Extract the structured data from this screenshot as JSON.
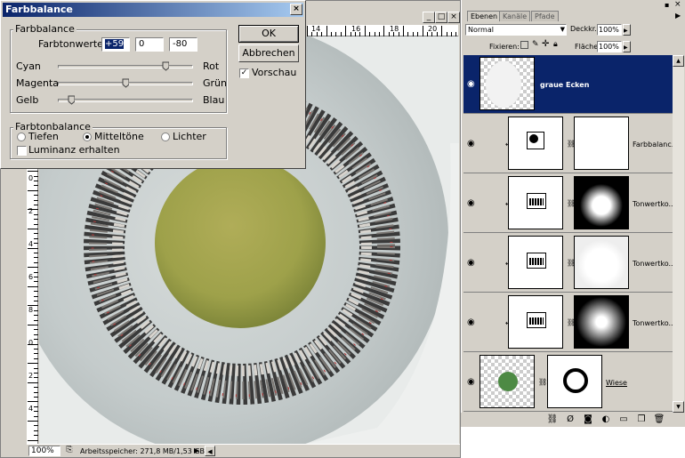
{
  "dialog": {
    "title": "Farbbalance",
    "close": "×",
    "group1_label": "Farbbalance",
    "values_label": "Farbtonwerte:",
    "values": [
      "+59",
      "0",
      "-80"
    ],
    "sliders": [
      {
        "left": "Cyan",
        "right": "Rot",
        "value": 59
      },
      {
        "left": "Magenta",
        "right": "Grün",
        "value": 0
      },
      {
        "left": "Gelb",
        "right": "Blau",
        "value": -80
      }
    ],
    "group2_label": "Farbtonbalance",
    "tones": [
      "Tiefen",
      "Mitteltöne",
      "Lichter"
    ],
    "tone_selected": "Mitteltöne",
    "luminance_label": "Luminanz erhalten",
    "ok": "OK",
    "cancel": "Abbrechen",
    "preview_label": "Vorschau",
    "preview_checked": true
  },
  "document": {
    "ruler_top_labels": [
      "14",
      "16",
      "18",
      "20"
    ],
    "ruler_left_labels": [
      "2",
      "4",
      "6",
      "8",
      "0",
      "2",
      "4",
      "6",
      "8",
      "0",
      "2",
      "4"
    ],
    "zoom": "100%",
    "status_text": "Arbeitsspeicher: 271,8 MB/1,53 GB",
    "status_arrow": "▶",
    "scroll_left_arrow": "◀"
  },
  "layers_panel": {
    "tabs": [
      "Ebenen",
      "Kanäle",
      "Pfade"
    ],
    "blend_mode": "Normal",
    "opacity_label": "Deckkr.:",
    "opacity_value": "100%",
    "lock_label": "Fixieren:",
    "fill_label": "Fläche:",
    "fill_value": "100%",
    "layers": [
      {
        "name": "graue Ecken",
        "selected": true
      },
      {
        "name": "Farbbalanc...",
        "selected": false
      },
      {
        "name": "Tonwertko...",
        "selected": false
      },
      {
        "name": "Tonwertko...",
        "selected": false
      },
      {
        "name": "Tonwertko...",
        "selected": false
      },
      {
        "name": "Wiese",
        "selected": false
      }
    ]
  },
  "colors": {
    "selection": "#0a246a",
    "chrome": "#d4d0c8",
    "planet_green": "#9ea14a"
  }
}
